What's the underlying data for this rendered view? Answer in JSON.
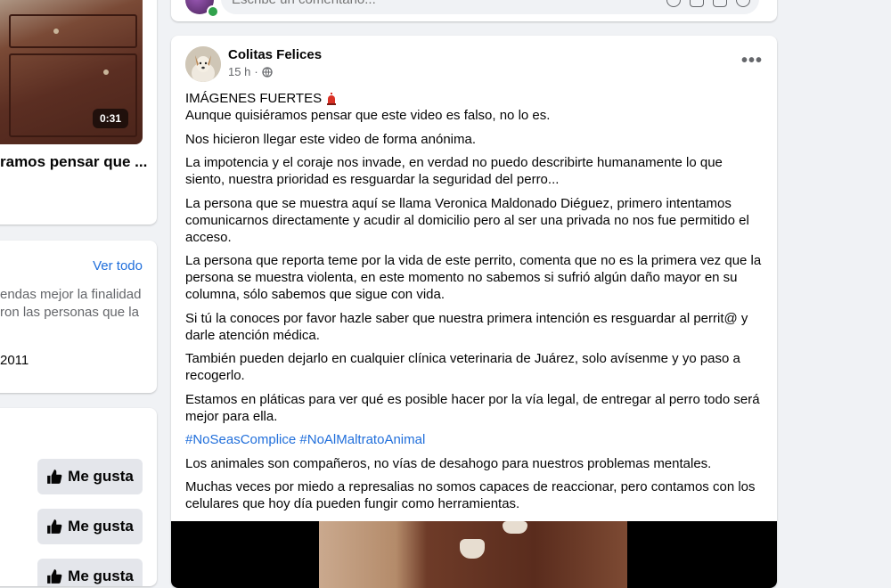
{
  "video_card": {
    "duration": "0:31",
    "title": "ramos pensar que ..."
  },
  "info_card": {
    "see_all": "Ver todo",
    "line1": "endas mejor la finalidad",
    "line2": "ron las personas que la",
    "year": "2011"
  },
  "likes_card": {
    "buttons": [
      "Me gusta",
      "Me gusta",
      "Me gusta"
    ]
  },
  "comment_box": {
    "placeholder": "Escribe un comentario..."
  },
  "post": {
    "author": "Colitas Felices",
    "time": "15 h",
    "separator": "·",
    "heading": "IMÁGENES FUERTES",
    "paragraphs": [
      "Aunque quisiéramos pensar que este video es falso, no lo es.",
      "Nos hicieron llegar este video de forma anónima.",
      "La impotencia y el coraje nos invade, en verdad no puedo describirte humanamente lo que siento, nuestra prioridad es resguardar la seguridad del perro...",
      "La persona que se muestra aquí se llama Veronica Maldonado Diéguez, primero  intentamos comunicarnos directamente y acudir al domicilio pero al ser una privada no nos fue permitido el acceso.",
      "La persona que reporta teme por la vida de este perrito, comenta que no es la primera vez que la persona se muestra violenta, en este momento no sabemos si sufrió algún daño mayor en su columna, sólo sabemos que sigue con vida.",
      "Si tú la conoces por favor hazle saber que nuestra primera intención es resguardar al perrit@ y darle atención médica.",
      "También pueden dejarlo en cualquier clínica veterinaria de Juárez, solo avísenme y yo paso a recogerlo.",
      "Estamos en pláticas para ver qué es posible hacer por la vía legal, de entregar al perro todo será mejor para ella."
    ],
    "hashtags": [
      "#NoSeasComplice",
      "#NoAlMaltratoAnimal"
    ],
    "closing": [
      "Los animales son compañeros, no vías de desahogo para nuestros problemas mentales.",
      "Muchas veces por miedo a represalias no somos capaces de reaccionar, pero contamos con los celulares que hoy día pueden fungir como herramientas."
    ]
  },
  "colors": {
    "link": "#216fdb",
    "secondary_text": "#65676b",
    "button_bg": "#e4e6eb",
    "page_bg": "#f0f2f5"
  }
}
